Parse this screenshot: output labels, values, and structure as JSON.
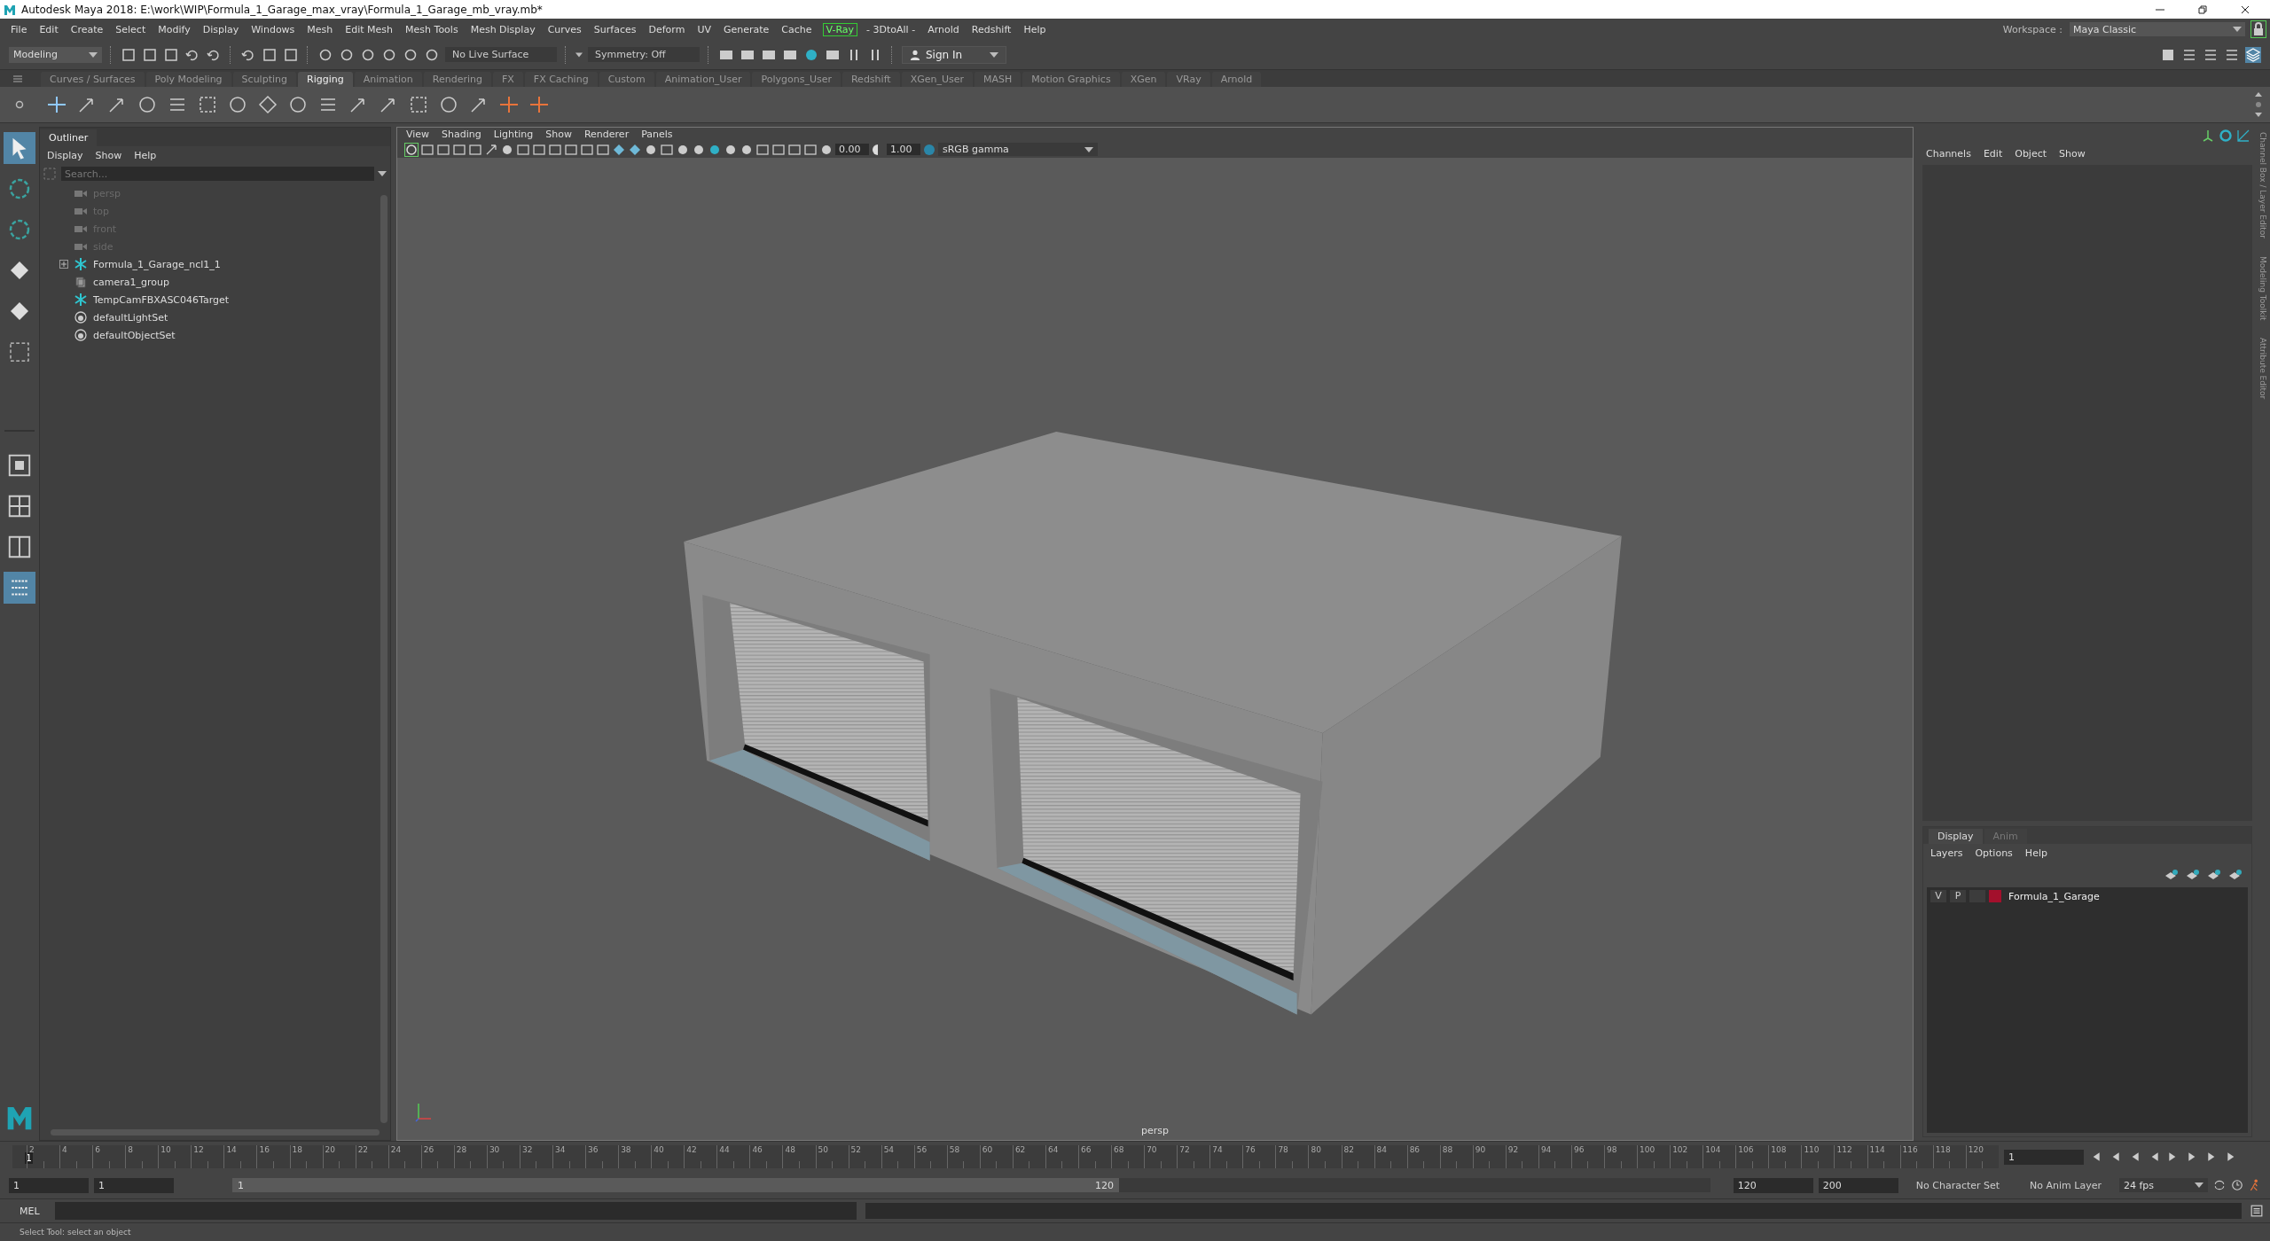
{
  "window": {
    "title": "Autodesk Maya 2018: E:\\work\\WIP\\Formula_1_Garage_max_vray\\Formula_1_Garage_mb_vray.mb*"
  },
  "menu_bar": [
    {
      "label": "File",
      "kind": "menu"
    },
    {
      "label": "Edit",
      "kind": "menu"
    },
    {
      "label": "Create",
      "kind": "menu"
    },
    {
      "label": "Select",
      "kind": "menu"
    },
    {
      "label": "Modify",
      "kind": "menu"
    },
    {
      "label": "Display",
      "kind": "menu"
    },
    {
      "label": "Windows",
      "kind": "menu"
    },
    {
      "label": "Mesh",
      "kind": "menu"
    },
    {
      "label": "Edit Mesh",
      "kind": "menu"
    },
    {
      "label": "Mesh Tools",
      "kind": "menu"
    },
    {
      "label": "Mesh Display",
      "kind": "menu"
    },
    {
      "label": "Curves",
      "kind": "menu"
    },
    {
      "label": "Surfaces",
      "kind": "menu"
    },
    {
      "label": "Deform",
      "kind": "menu"
    },
    {
      "label": "UV",
      "kind": "menu"
    },
    {
      "label": "Generate",
      "kind": "menu"
    },
    {
      "label": "Cache",
      "kind": "menu"
    },
    {
      "label": "V-Ray",
      "kind": "plugin"
    },
    {
      "label": "- 3DtoAll -",
      "kind": "menu"
    },
    {
      "label": "Arnold",
      "kind": "menu"
    },
    {
      "label": "Redshift",
      "kind": "menu"
    },
    {
      "label": "Help",
      "kind": "menu"
    }
  ],
  "workspace": {
    "label": "Workspace :",
    "value": "Maya Classic"
  },
  "status_line": {
    "mode": "Modeling",
    "live_surface": "No Live Surface",
    "symmetry": "Symmetry: Off",
    "sign_in": "Sign In"
  },
  "shelf_tabs": [
    {
      "label": "Curves / Surfaces",
      "selected": false
    },
    {
      "label": "Poly Modeling",
      "selected": false
    },
    {
      "label": "Sculpting",
      "selected": false
    },
    {
      "label": "Rigging",
      "selected": true
    },
    {
      "label": "Animation",
      "selected": false
    },
    {
      "label": "Rendering",
      "selected": false
    },
    {
      "label": "FX",
      "selected": false
    },
    {
      "label": "FX Caching",
      "selected": false
    },
    {
      "label": "Custom",
      "selected": false
    },
    {
      "label": "Animation_User",
      "selected": false
    },
    {
      "label": "Polygons_User",
      "selected": false
    },
    {
      "label": "Redshift",
      "selected": false
    },
    {
      "label": "XGen_User",
      "selected": false
    },
    {
      "label": "MASH",
      "selected": false
    },
    {
      "label": "Motion Graphics",
      "selected": false
    },
    {
      "label": "XGen",
      "selected": false
    },
    {
      "label": "VRay",
      "selected": false
    },
    {
      "label": "Arnold",
      "selected": false
    }
  ],
  "outliner": {
    "title": "Outliner",
    "menu": [
      "Display",
      "Show",
      "Help"
    ],
    "search_placeholder": "Search...",
    "items": [
      {
        "label": "persp",
        "kind": "camera",
        "dimmed": true,
        "expandable": false
      },
      {
        "label": "top",
        "kind": "camera",
        "dimmed": true,
        "expandable": false
      },
      {
        "label": "front",
        "kind": "camera",
        "dimmed": true,
        "expandable": false
      },
      {
        "label": "side",
        "kind": "camera",
        "dimmed": true,
        "expandable": false
      },
      {
        "label": "Formula_1_Garage_ncl1_1",
        "kind": "locator",
        "dimmed": false,
        "expandable": true
      },
      {
        "label": "camera1_group",
        "kind": "group",
        "dimmed": false,
        "expandable": false
      },
      {
        "label": "TempCamFBXASC046Target",
        "kind": "locator",
        "dimmed": false,
        "expandable": false
      },
      {
        "label": "defaultLightSet",
        "kind": "set",
        "dimmed": false,
        "expandable": false
      },
      {
        "label": "defaultObjectSet",
        "kind": "set",
        "dimmed": false,
        "expandable": false
      }
    ]
  },
  "viewport": {
    "menu": [
      "View",
      "Shading",
      "Lighting",
      "Show",
      "Renderer",
      "Panels"
    ],
    "exposure": "0.00",
    "gamma": "1.00",
    "color_space": "sRGB gamma",
    "camera": "persp"
  },
  "channel_box": {
    "menu": [
      "Channels",
      "Edit",
      "Object",
      "Show"
    ]
  },
  "layer_editor": {
    "tabs": [
      {
        "label": "Display",
        "selected": true
      },
      {
        "label": "Anim",
        "selected": false
      }
    ],
    "menu": [
      "Layers",
      "Options",
      "Help"
    ],
    "layers": [
      {
        "visibility": "V",
        "playback": "P",
        "name": "Formula_1_Garage",
        "color": "#a3102c"
      }
    ]
  },
  "side_tabs": [
    "Channel Box / Layer Editor",
    "Modeling Toolkit",
    "Attribute Editor"
  ],
  "time_slider": {
    "level": 0,
    "current_frame": "1",
    "frame_field": "1",
    "ticks": [
      "2",
      "4",
      "6",
      "8",
      "10",
      "12",
      "14",
      "16",
      "18",
      "20",
      "22",
      "24",
      "26",
      "28",
      "30",
      "32",
      "34",
      "36",
      "38",
      "40",
      "42",
      "44",
      "46",
      "48",
      "50",
      "52",
      "54",
      "56",
      "58",
      "60",
      "62",
      "64",
      "66",
      "68",
      "70",
      "72",
      "74",
      "76",
      "78",
      "80",
      "82",
      "84",
      "86",
      "88",
      "90",
      "92",
      "94",
      "96",
      "98",
      "100",
      "102",
      "104",
      "106",
      "108",
      "110",
      "112",
      "114",
      "116",
      "118",
      "120"
    ]
  },
  "range_slider": {
    "level": 0.6,
    "start": "1",
    "playback_start": "1",
    "bar_start": "1",
    "bar_end": "120",
    "playback_end": "120",
    "end": "200",
    "character_set": "No Character Set",
    "anim_layer": "No Anim Layer",
    "fps": "24 fps"
  },
  "command_line": {
    "language": "MEL"
  },
  "help_line": "Select Tool: select an object"
}
